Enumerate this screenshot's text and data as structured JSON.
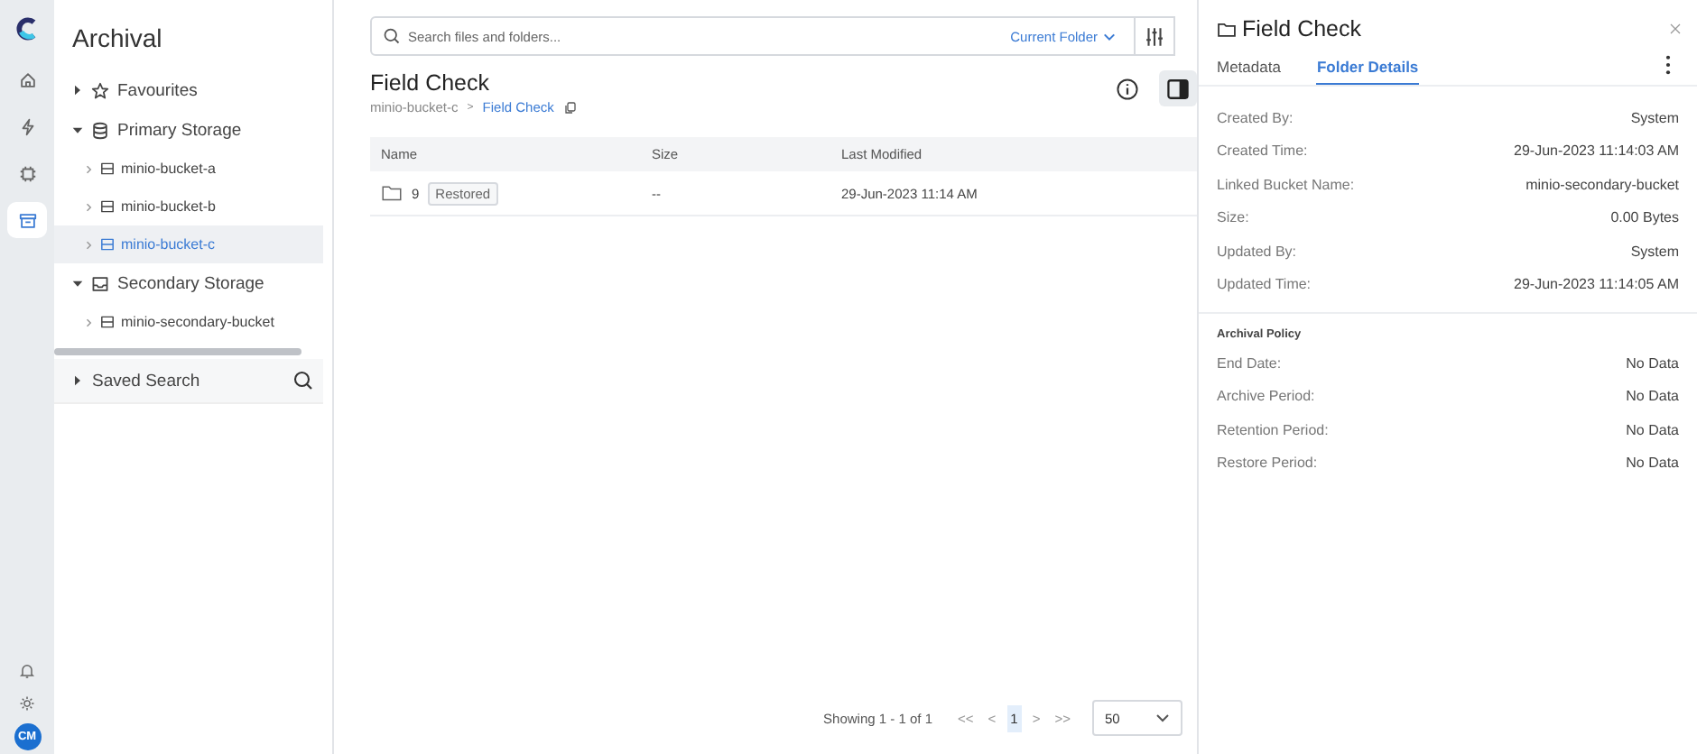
{
  "rail": {
    "items": [
      {
        "kind": "home",
        "selected": false
      },
      {
        "kind": "bolt",
        "selected": false
      },
      {
        "kind": "chip",
        "selected": false
      },
      {
        "kind": "archive",
        "selected": true
      }
    ],
    "bottom": [
      {
        "kind": "bell"
      },
      {
        "kind": "gear"
      }
    ],
    "avatar": "CM"
  },
  "sidebar": {
    "title": "Archival",
    "tree": [
      {
        "label": "Favourites",
        "kind": "star",
        "expanded": false,
        "selected": false
      },
      {
        "label": "Primary Storage",
        "kind": "database",
        "expanded": true,
        "selected": false,
        "children": [
          {
            "label": "minio-bucket-a",
            "kind": "bucket",
            "expanded": false,
            "selected": false
          },
          {
            "label": "minio-bucket-b",
            "kind": "bucket",
            "expanded": false,
            "selected": false
          },
          {
            "label": "minio-bucket-c",
            "kind": "bucket",
            "expanded": false,
            "selected": true
          }
        ]
      },
      {
        "label": "Secondary Storage",
        "kind": "drive",
        "expanded": true,
        "selected": false,
        "children": [
          {
            "label": "minio-secondary-bucket",
            "kind": "bucket",
            "expanded": false,
            "selected": false
          }
        ]
      }
    ],
    "saved_search": {
      "label": "Saved Search",
      "expanded": false
    }
  },
  "search": {
    "placeholder": "Search files and folders...",
    "scope": "Current Folder"
  },
  "page": {
    "title": "Field Check",
    "breadcrumb": [
      {
        "label": "minio-bucket-c",
        "current": false
      },
      {
        "label": "Field Check",
        "current": true
      }
    ],
    "separator": ">"
  },
  "table": {
    "columns": [
      "Name",
      "Size",
      "Last Modified"
    ],
    "rows": [
      {
        "name": "9",
        "badge": "Restored",
        "size": "--",
        "modified": "29-Jun-2023 11:14 AM"
      }
    ]
  },
  "pagination": {
    "summary": "Showing 1 - 1 of 1",
    "first": "<<",
    "prev": "<",
    "pages": [
      {
        "label": "1",
        "selected": true
      }
    ],
    "next": ">",
    "last": ">>",
    "page_size": "50"
  },
  "details": {
    "title": "Field Check",
    "tabs": [
      {
        "label": "Metadata",
        "selected": false
      },
      {
        "label": "Folder Details",
        "selected": true
      }
    ],
    "fields": [
      {
        "label": "Created By:",
        "value": "System"
      },
      {
        "label": "Created Time:",
        "value": "29-Jun-2023 11:14:03 AM"
      },
      {
        "label": "Linked Bucket Name:",
        "value": "minio-secondary-bucket"
      },
      {
        "label": "Size:",
        "value": "0.00 Bytes"
      },
      {
        "label": "Updated By:",
        "value": "System"
      },
      {
        "label": "Updated Time:",
        "value": "29-Jun-2023 11:14:05 AM"
      }
    ],
    "policy_title": "Archival Policy",
    "policy": [
      {
        "label": "End Date:",
        "value": "No Data"
      },
      {
        "label": "Archive Period:",
        "value": "No Data"
      },
      {
        "label": "Retention Period:",
        "value": "No Data"
      },
      {
        "label": "Restore Period:",
        "value": "No Data"
      }
    ]
  }
}
